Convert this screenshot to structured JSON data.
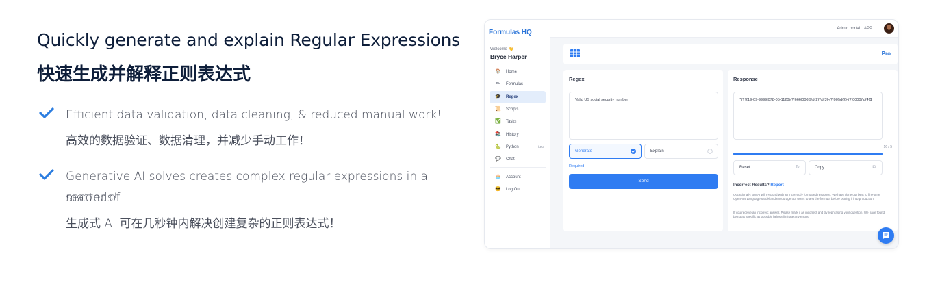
{
  "hero": {
    "title_en": "Quickly generate and explain Regular Expressions",
    "title_zh": "快速生成并解释正则表达式"
  },
  "features": [
    {
      "icon": "check-icon",
      "en": "Efficient data validation, data cleaning, & reduced manual work!",
      "zh": "高效的数据验证、数据清理，并减少手动工作！"
    },
    {
      "icon": "check-icon",
      "en_line1": "Generative AI solves creates complex regular expressions in a matter of",
      "en_line2": "seconds!",
      "zh": "生成式 AI 可在几秒钟内解决创建复杂的正则表达式！"
    }
  ],
  "colors": {
    "accent": "#2f7cf2",
    "brand": "#2a74d8",
    "heading": "#0e1e3a",
    "check": "#2b7de0"
  },
  "app": {
    "brand": "Formulas HQ",
    "welcome": "Welcome 👋",
    "username": "Bryce Harper",
    "topbar": {
      "admin_portal": "Admin portal",
      "app": "APP"
    },
    "nav": [
      {
        "label": "Home",
        "icon": "home-icon",
        "glyph": "🏠"
      },
      {
        "label": "Formulas",
        "icon": "pencil-icon",
        "glyph": "✏"
      },
      {
        "label": "Regex",
        "icon": "graduation-cap-icon",
        "glyph": "🎓",
        "active": true
      },
      {
        "label": "Scripts",
        "icon": "scroll-icon",
        "glyph": "📜"
      },
      {
        "label": "Tasks",
        "icon": "checkbox-icon",
        "glyph": "✅"
      },
      {
        "label": "History",
        "icon": "history-icon",
        "glyph": "📚"
      },
      {
        "label": "Python",
        "icon": "python-icon",
        "glyph": "🐍",
        "badge": "beta"
      },
      {
        "label": "Chat",
        "icon": "chat-icon",
        "glyph": "💬"
      }
    ],
    "nav_bottom": [
      {
        "label": "Account",
        "icon": "account-icon",
        "glyph": "🧁"
      },
      {
        "label": "Log Out",
        "icon": "logout-icon",
        "glyph": "😎"
      }
    ],
    "plan": "Pro",
    "regex_panel": {
      "title": "Regex",
      "input_value": "Valid US social security number",
      "generate_label": "Generate",
      "explain_label": "Explain",
      "required_label": "Required",
      "send_label": "Send"
    },
    "response_panel": {
      "title": "Response",
      "output": "^(?!219-09-9999|078-05-1120)(?!666|000|9\\d{2})\\d{3}-(?!00)\\d{2}-(?!0000)\\d{4}$",
      "counter": "16 / 5",
      "progress": 1.0,
      "reset_label": "Reset",
      "copy_label": "Copy",
      "incorrect_title": "Incorrect Results?",
      "report_label": "Report",
      "note_1": "Occasionally, our AI will respond with an incorrectly formatted response. We have done our best to fine-tune OpenAI's Language Model and encourage our users to test the formula before putting it into production.",
      "note_2": "If you receive an incorrect answer, Please mark it as incorrect and try rephrasing your question. We have found being as specific as possible helps eliminate any errors."
    }
  }
}
